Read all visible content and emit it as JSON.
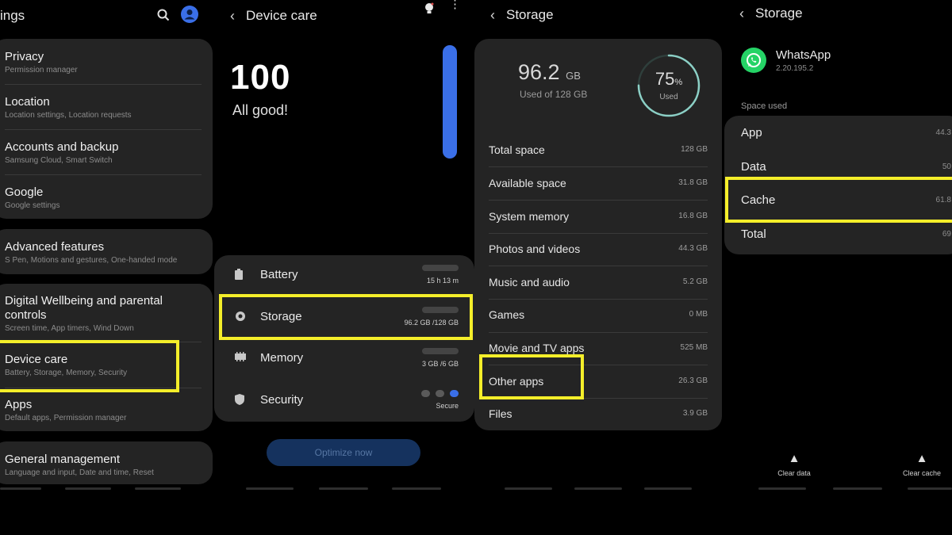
{
  "panel1": {
    "title": "ings",
    "groups": [
      {
        "items": [
          {
            "title": "Privacy",
            "subtitle": "Permission manager"
          },
          {
            "title": "Location",
            "subtitle": "Location settings, Location requests"
          },
          {
            "title": "Accounts and backup",
            "subtitle": "Samsung Cloud, Smart Switch"
          },
          {
            "title": "Google",
            "subtitle": "Google settings"
          }
        ]
      },
      {
        "items": [
          {
            "title": "Advanced features",
            "subtitle": "S Pen, Motions and gestures, One-handed mode"
          }
        ]
      },
      {
        "items": [
          {
            "title": "Digital Wellbeing and parental controls",
            "subtitle": "Screen time, App timers, Wind Down"
          },
          {
            "title": "Device care",
            "subtitle": "Battery, Storage, Memory, Security"
          },
          {
            "title": "Apps",
            "subtitle": "Default apps, Permission manager"
          }
        ]
      },
      {
        "items": [
          {
            "title": "General management",
            "subtitle": "Language and input, Date and time, Reset"
          }
        ]
      }
    ]
  },
  "panel2": {
    "title": "Device care",
    "score": "100",
    "status": "All good!",
    "items": [
      {
        "label": "Battery",
        "value": "15 h 13 m",
        "fill": 0.75
      },
      {
        "label": "Storage",
        "value": "96.2 GB /128 GB",
        "fill": 0.75
      },
      {
        "label": "Memory",
        "value": "3 GB /6 GB",
        "fill": 0.5
      },
      {
        "label": "Security",
        "value": "Secure"
      }
    ],
    "button": "Optimize now"
  },
  "panel3": {
    "title": "Storage",
    "used_value": "96.2",
    "used_unit": "GB",
    "used_of": "Used of 128 GB",
    "percent": "75",
    "percent_sign": "%",
    "percent_label": "Used",
    "rows": [
      {
        "label": "Total space",
        "value": "128 GB"
      },
      {
        "label": "Available space",
        "value": "31.8 GB"
      },
      {
        "label": "System memory",
        "value": "16.8 GB"
      },
      {
        "label": "Photos and videos",
        "value": "44.3 GB"
      },
      {
        "label": "Music and audio",
        "value": "5.2 GB"
      },
      {
        "label": "Games",
        "value": "0 MB"
      },
      {
        "label": "Movie and TV apps",
        "value": "525 MB"
      },
      {
        "label": "Other apps",
        "value": "26.3 GB"
      },
      {
        "label": "Files",
        "value": "3.9 GB"
      }
    ]
  },
  "panel4": {
    "title": "Storage",
    "app_name": "WhatsApp",
    "app_version": "2.20.195.2",
    "space_header": "Space used",
    "rows": [
      {
        "label": "App",
        "value": "44.3"
      },
      {
        "label": "Data",
        "value": "50"
      },
      {
        "label": "Cache",
        "value": "61.8"
      },
      {
        "label": "Total",
        "value": "69"
      }
    ],
    "clear_data": "Clear data",
    "clear_cache": "Clear cache"
  },
  "colors": {
    "highlight": "#f4ee2a",
    "accent": "#3a6fe8",
    "bar_green": "#53b85a",
    "whatsapp": "#25d366"
  }
}
